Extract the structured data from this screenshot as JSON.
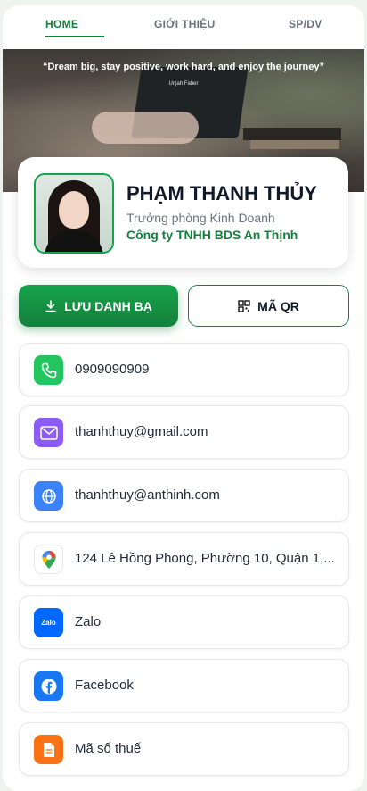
{
  "tabs": [
    {
      "label": "HOME",
      "active": true
    },
    {
      "label": "GIỚI THIỆU",
      "active": false
    },
    {
      "label": "SP/DV",
      "active": false
    }
  ],
  "hero": {
    "quote": "“Dream big, stay positive, work hard, and enjoy the journey”",
    "author": "Urijah Faber"
  },
  "profile": {
    "name": "PHẠM THANH THỦY",
    "role": "Trưởng phòng Kinh Doanh",
    "company": "Công ty TNHH BDS An Thịnh"
  },
  "actions": {
    "save_label": "LƯU DANH BẠ",
    "qr_label": "MÃ QR"
  },
  "contacts": [
    {
      "type": "phone",
      "text": "0909090909",
      "icon": "phone-icon",
      "color": "#22c55e"
    },
    {
      "type": "email",
      "text": "thanhthuy@gmail.com",
      "icon": "mail-icon",
      "color": "#8b5cf6"
    },
    {
      "type": "website",
      "text": "thanhthuy@anthinh.com",
      "icon": "globe-icon",
      "color": "#3b82f6"
    },
    {
      "type": "address",
      "text": "124 Lê Hồng Phong, Phường 10, Quận 1,...",
      "icon": "map-pin-icon",
      "color": "#ffffff"
    },
    {
      "type": "zalo",
      "text": "Zalo",
      "icon": "zalo-icon",
      "icon_text": "Zalo",
      "color": "#0068ff"
    },
    {
      "type": "facebook",
      "text": "Facebook",
      "icon": "facebook-icon",
      "color": "#1877f2"
    },
    {
      "type": "tax",
      "text": "Mã số thuế",
      "icon": "document-icon",
      "color": "#f97316"
    }
  ],
  "colors": {
    "brand": "#15803d",
    "accent": "#16a34a"
  }
}
